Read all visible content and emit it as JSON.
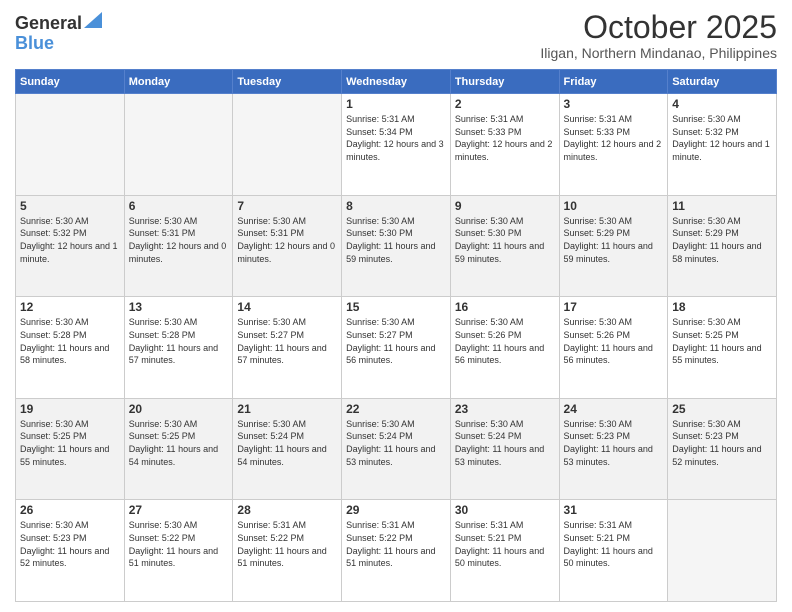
{
  "logo": {
    "line1": "General",
    "line2": "Blue"
  },
  "header": {
    "title": "October 2025",
    "subtitle": "Iligan, Northern Mindanao, Philippines"
  },
  "days_of_week": [
    "Sunday",
    "Monday",
    "Tuesday",
    "Wednesday",
    "Thursday",
    "Friday",
    "Saturday"
  ],
  "weeks": [
    [
      {
        "day": "",
        "info": ""
      },
      {
        "day": "",
        "info": ""
      },
      {
        "day": "",
        "info": ""
      },
      {
        "day": "1",
        "info": "Sunrise: 5:31 AM\nSunset: 5:34 PM\nDaylight: 12 hours and 3 minutes."
      },
      {
        "day": "2",
        "info": "Sunrise: 5:31 AM\nSunset: 5:33 PM\nDaylight: 12 hours and 2 minutes."
      },
      {
        "day": "3",
        "info": "Sunrise: 5:31 AM\nSunset: 5:33 PM\nDaylight: 12 hours and 2 minutes."
      },
      {
        "day": "4",
        "info": "Sunrise: 5:30 AM\nSunset: 5:32 PM\nDaylight: 12 hours and 1 minute."
      }
    ],
    [
      {
        "day": "5",
        "info": "Sunrise: 5:30 AM\nSunset: 5:32 PM\nDaylight: 12 hours and 1 minute."
      },
      {
        "day": "6",
        "info": "Sunrise: 5:30 AM\nSunset: 5:31 PM\nDaylight: 12 hours and 0 minutes."
      },
      {
        "day": "7",
        "info": "Sunrise: 5:30 AM\nSunset: 5:31 PM\nDaylight: 12 hours and 0 minutes."
      },
      {
        "day": "8",
        "info": "Sunrise: 5:30 AM\nSunset: 5:30 PM\nDaylight: 11 hours and 59 minutes."
      },
      {
        "day": "9",
        "info": "Sunrise: 5:30 AM\nSunset: 5:30 PM\nDaylight: 11 hours and 59 minutes."
      },
      {
        "day": "10",
        "info": "Sunrise: 5:30 AM\nSunset: 5:29 PM\nDaylight: 11 hours and 59 minutes."
      },
      {
        "day": "11",
        "info": "Sunrise: 5:30 AM\nSunset: 5:29 PM\nDaylight: 11 hours and 58 minutes."
      }
    ],
    [
      {
        "day": "12",
        "info": "Sunrise: 5:30 AM\nSunset: 5:28 PM\nDaylight: 11 hours and 58 minutes."
      },
      {
        "day": "13",
        "info": "Sunrise: 5:30 AM\nSunset: 5:28 PM\nDaylight: 11 hours and 57 minutes."
      },
      {
        "day": "14",
        "info": "Sunrise: 5:30 AM\nSunset: 5:27 PM\nDaylight: 11 hours and 57 minutes."
      },
      {
        "day": "15",
        "info": "Sunrise: 5:30 AM\nSunset: 5:27 PM\nDaylight: 11 hours and 56 minutes."
      },
      {
        "day": "16",
        "info": "Sunrise: 5:30 AM\nSunset: 5:26 PM\nDaylight: 11 hours and 56 minutes."
      },
      {
        "day": "17",
        "info": "Sunrise: 5:30 AM\nSunset: 5:26 PM\nDaylight: 11 hours and 56 minutes."
      },
      {
        "day": "18",
        "info": "Sunrise: 5:30 AM\nSunset: 5:25 PM\nDaylight: 11 hours and 55 minutes."
      }
    ],
    [
      {
        "day": "19",
        "info": "Sunrise: 5:30 AM\nSunset: 5:25 PM\nDaylight: 11 hours and 55 minutes."
      },
      {
        "day": "20",
        "info": "Sunrise: 5:30 AM\nSunset: 5:25 PM\nDaylight: 11 hours and 54 minutes."
      },
      {
        "day": "21",
        "info": "Sunrise: 5:30 AM\nSunset: 5:24 PM\nDaylight: 11 hours and 54 minutes."
      },
      {
        "day": "22",
        "info": "Sunrise: 5:30 AM\nSunset: 5:24 PM\nDaylight: 11 hours and 53 minutes."
      },
      {
        "day": "23",
        "info": "Sunrise: 5:30 AM\nSunset: 5:24 PM\nDaylight: 11 hours and 53 minutes."
      },
      {
        "day": "24",
        "info": "Sunrise: 5:30 AM\nSunset: 5:23 PM\nDaylight: 11 hours and 53 minutes."
      },
      {
        "day": "25",
        "info": "Sunrise: 5:30 AM\nSunset: 5:23 PM\nDaylight: 11 hours and 52 minutes."
      }
    ],
    [
      {
        "day": "26",
        "info": "Sunrise: 5:30 AM\nSunset: 5:23 PM\nDaylight: 11 hours and 52 minutes."
      },
      {
        "day": "27",
        "info": "Sunrise: 5:30 AM\nSunset: 5:22 PM\nDaylight: 11 hours and 51 minutes."
      },
      {
        "day": "28",
        "info": "Sunrise: 5:31 AM\nSunset: 5:22 PM\nDaylight: 11 hours and 51 minutes."
      },
      {
        "day": "29",
        "info": "Sunrise: 5:31 AM\nSunset: 5:22 PM\nDaylight: 11 hours and 51 minutes."
      },
      {
        "day": "30",
        "info": "Sunrise: 5:31 AM\nSunset: 5:21 PM\nDaylight: 11 hours and 50 minutes."
      },
      {
        "day": "31",
        "info": "Sunrise: 5:31 AM\nSunset: 5:21 PM\nDaylight: 11 hours and 50 minutes."
      },
      {
        "day": "",
        "info": ""
      }
    ]
  ]
}
